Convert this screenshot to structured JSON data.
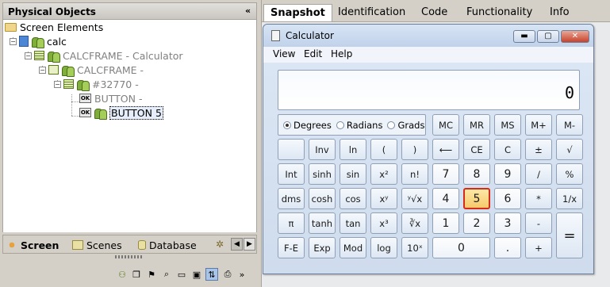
{
  "left_panel": {
    "title": "Physical Objects",
    "collapse_glyph": "«",
    "tree": {
      "root": "Screen Elements",
      "app": "calc",
      "frame": "CALCFRAME - Calculator",
      "frame_child": "CALCFRAME -",
      "group": "#32770 -",
      "button1": "BUTTON -",
      "button2": "BUTTON 5"
    },
    "bottom_tabs": {
      "screen": "Screen",
      "scenes": "Scenes",
      "database": "Database"
    }
  },
  "right_panel": {
    "tabs": [
      "Snapshot",
      "Identification",
      "Code",
      "Functionality",
      "Info"
    ],
    "active_tab": "Snapshot"
  },
  "calculator": {
    "title": "Calculator",
    "menu": [
      "View",
      "Edit",
      "Help"
    ],
    "display": "0",
    "angle_modes": [
      "Degrees",
      "Radians",
      "Grads"
    ],
    "selected_angle": "Degrees",
    "highlight_key": "5",
    "keys": {
      "mc": "MC",
      "mr": "MR",
      "ms": "MS",
      "mplus": "M+",
      "mminus": "M-",
      "inv": "Inv",
      "ln": "ln",
      "lparen": "(",
      "rparen": ")",
      "back": "⟵",
      "ce": "CE",
      "c": "C",
      "pm": "±",
      "sqrt": "√",
      "int": "Int",
      "sinh": "sinh",
      "sin": "sin",
      "x2": "x²",
      "fact": "n!",
      "k7": "7",
      "k8": "8",
      "k9": "9",
      "div": "/",
      "pct": "%",
      "dms": "dms",
      "cosh": "cosh",
      "cos": "cos",
      "xy": "xʸ",
      "yroot": "ʸ√x",
      "k4": "4",
      "k5": "5",
      "k6": "6",
      "mul": "*",
      "recip": "1/x",
      "pi": "π",
      "tanh": "tanh",
      "tan": "tan",
      "x3": "x³",
      "croot": "∛x",
      "k1": "1",
      "k2": "2",
      "k3": "3",
      "sub": "-",
      "eq": "=",
      "fe": "F-E",
      "exp": "Exp",
      "mod": "Mod",
      "log": "log",
      "ten": "10ˣ",
      "k0": "0",
      "dot": ".",
      "add": "+"
    }
  }
}
